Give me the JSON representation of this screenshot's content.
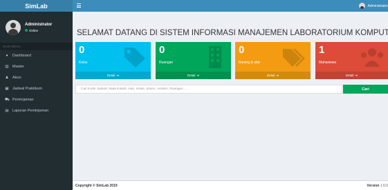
{
  "brand": "SimLab",
  "user": {
    "name": "Administrator",
    "status": "Online"
  },
  "sidebar": {
    "header": "MAIN MENU",
    "items": [
      {
        "label": "Dashboard",
        "icon": "dashboard-icon"
      },
      {
        "label": "Master",
        "icon": "bank-icon"
      },
      {
        "label": "Akun",
        "icon": "user-icon"
      },
      {
        "label": "Jadwal Praktikum",
        "icon": "calendar-icon"
      },
      {
        "label": "Peminjaman",
        "icon": "cart-icon"
      },
      {
        "label": "Laporan Peminjaman",
        "icon": "file-icon"
      }
    ]
  },
  "topbar": {
    "user_label": "Administrator"
  },
  "page_title": "SELAMAT DATANG DI SISTEM INFORMASI MANAJEMEN LABORATORIUM KOMPUTER",
  "boxes": [
    {
      "count": "0",
      "label": "Kelas",
      "footer": "Detail",
      "color": "#00c0ef",
      "icon": "tag-icon"
    },
    {
      "count": "0",
      "label": "Ruangan",
      "footer": "Detail",
      "color": "#00a65a",
      "icon": "building-icon"
    },
    {
      "count": "0",
      "label": "Barang & alat",
      "footer": "Detail",
      "color": "#f39c12",
      "icon": "tags-icon"
    },
    {
      "count": "1",
      "label": "Mahasiswa",
      "footer": "Detail",
      "color": "#dd4b39",
      "icon": "users-icon"
    }
  ],
  "search": {
    "placeholder": "Cari Kode Jadwal, Mata Kuliah, Hari, Kelas, dosen, Asisten, Ruangan ...",
    "button": "Cari"
  },
  "footer": {
    "copyright": "Copyright © SimLab 2019",
    "version_label": "Version",
    "version": "1.0.0"
  }
}
